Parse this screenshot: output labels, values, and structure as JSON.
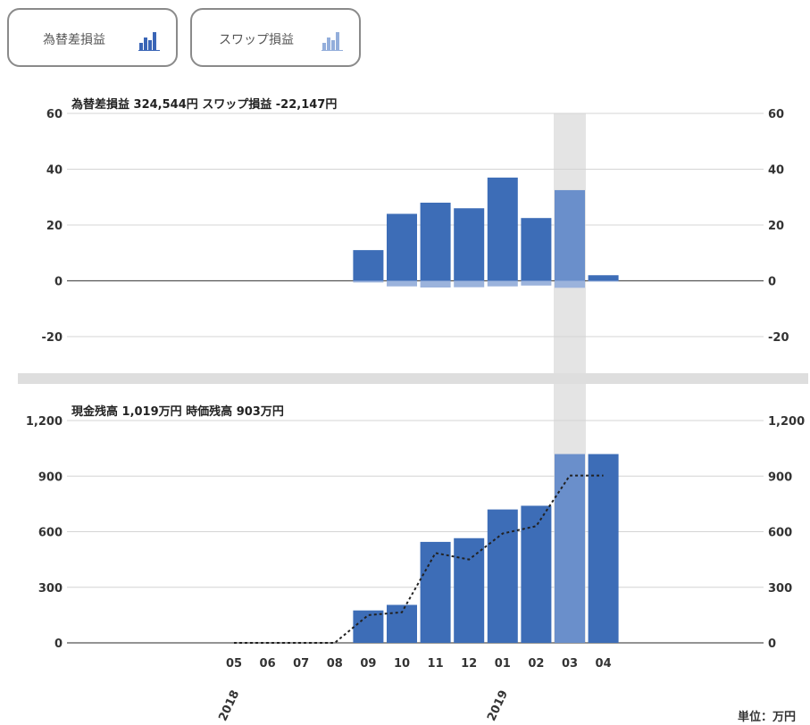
{
  "toggles": [
    {
      "label": "為替差損益",
      "icon": "bar-chart-icon",
      "color": "#3a65b6",
      "active": true
    },
    {
      "label": "スワップ損益",
      "icon": "bar-chart-icon",
      "color": "#93aedb",
      "active": false
    }
  ],
  "chart_data": [
    {
      "type": "bar",
      "header": "為替差損益 324,544円 スワップ損益 -22,147円",
      "categories": [
        "05",
        "06",
        "07",
        "08",
        "09",
        "10",
        "11",
        "12",
        "01",
        "02",
        "03",
        "04"
      ],
      "series": [
        {
          "name": "為替差損益",
          "values": [
            0,
            0,
            0,
            0,
            11,
            24,
            28,
            26,
            37,
            22.5,
            32.5,
            2
          ]
        },
        {
          "name": "スワップ損益",
          "values": [
            0,
            0,
            0,
            0,
            -0.6,
            -2,
            -2.4,
            -2.3,
            -2,
            -1.7,
            -2.5,
            -0.3
          ]
        }
      ],
      "ylim": [
        -30,
        60
      ],
      "yticks": [
        60,
        40,
        20,
        0,
        -20
      ],
      "grid": true,
      "highlight_category": "03"
    },
    {
      "type": "bar",
      "header": "現金残高 1,019万円 時価残高 903万円",
      "categories": [
        "05",
        "06",
        "07",
        "08",
        "09",
        "10",
        "11",
        "12",
        "01",
        "02",
        "03",
        "04"
      ],
      "series": [
        {
          "name": "現金残高",
          "type": "bar",
          "values": [
            0,
            0,
            0,
            0,
            175,
            205,
            545,
            565,
            720,
            740,
            1019,
            1019
          ]
        },
        {
          "name": "時価残高",
          "type": "line",
          "values": [
            0,
            0,
            0,
            0,
            150,
            165,
            485,
            450,
            590,
            630,
            903,
            903
          ]
        }
      ],
      "ylim": [
        0,
        1200
      ],
      "yticks": [
        "1,200",
        "900",
        "600",
        "300",
        "0"
      ],
      "grid": true,
      "highlight_category": "03",
      "year_labels": [
        {
          "label": "2018",
          "at": "05"
        },
        {
          "label": "2019",
          "at": "01"
        }
      ],
      "unit": "単位：万円"
    }
  ],
  "colors": {
    "bar": "#3d6db7",
    "bar_highlight": "#6a8fcb",
    "swap": "#9bb3dc",
    "highlight_band": "#e4e4e4",
    "separator": "#dedede",
    "grid": "#d4d4d4",
    "zero_line": "#555555",
    "line": "#222222"
  }
}
